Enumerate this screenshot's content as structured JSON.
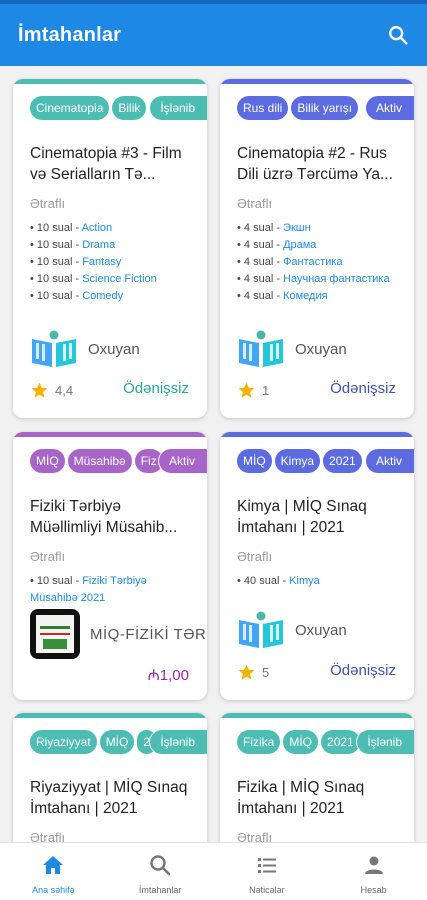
{
  "appbar": {
    "title": "İmtahanlar",
    "search_icon": "search-icon"
  },
  "cards": [
    {
      "tags": [
        "Cinematopia",
        "Bilik"
      ],
      "status": "İşlənib",
      "title": "Cinematopia #3 - Film və Serialların Tə...",
      "detail": "Ətraflı",
      "items": [
        {
          "count": "10 sual",
          "topic": "Action"
        },
        {
          "count": "10 sual",
          "topic": "Drama"
        },
        {
          "count": "10 sual",
          "topic": "Fantasy"
        },
        {
          "count": "10 sual",
          "topic": "Science Fiction"
        },
        {
          "count": "10 sual",
          "topic": "Comedy"
        }
      ],
      "author": "Oxuyan",
      "rating": "4,4",
      "price": "Ödənişsiz"
    },
    {
      "tags": [
        "Rus dili",
        "Bilik yarışı"
      ],
      "status": "Aktiv",
      "title": "Cinematopia #2 - Rus Dili üzrə Tərcümə Ya...",
      "detail": "Ətraflı",
      "items": [
        {
          "count": "4 sual",
          "topic": "Экшн"
        },
        {
          "count": "4 sual",
          "topic": "Драма"
        },
        {
          "count": "4 sual",
          "topic": "Фантастика"
        },
        {
          "count": "4 sual",
          "topic": "Научная фантастика"
        },
        {
          "count": "4 sual",
          "topic": "Комедия"
        }
      ],
      "author": "Oxuyan",
      "rating": "1",
      "price": "Ödənişsiz"
    },
    {
      "tags": [
        "MİQ",
        "Müsahibə",
        "Fiz"
      ],
      "status": "Aktiv",
      "title": "Fiziki Tərbiyə Müəllimliyi Müsahib...",
      "detail": "Ətraflı",
      "items": [
        {
          "count": "10 sual",
          "topic": "Fiziki Tərbiyə Müsahibə 2021"
        }
      ],
      "author": "MİQ-FİZİKİ TƏRBİYƏ",
      "price": "₼1,00"
    },
    {
      "tags": [
        "MİQ",
        "Kimya",
        "2021"
      ],
      "status": "Aktiv",
      "title": "Kimya | MİQ Sınaq İmtahanı | 2021",
      "detail": "Ətraflı",
      "items": [
        {
          "count": "40 sual",
          "topic": "Kimya"
        }
      ],
      "author": "Oxuyan",
      "rating": "5",
      "price": "Ödənişsiz"
    },
    {
      "tags": [
        "Riyaziyyat",
        "MİQ",
        "2"
      ],
      "status": "İşlənib",
      "title": "Riyaziyyat | MİQ Sınaq İmtahanı | 2021",
      "detail": "Ətraflı"
    },
    {
      "tags": [
        "Fizika",
        "MİQ",
        "2021"
      ],
      "status": "İşlənib",
      "title": "Fizika | MİQ Sınaq İmtahanı | 2021",
      "detail": "Ətraflı"
    }
  ],
  "bottom_nav": [
    {
      "label": "Ana səhifə",
      "icon": "home-icon"
    },
    {
      "label": "İmtahanlar",
      "icon": "search-icon"
    },
    {
      "label": "Nəticələr",
      "icon": "list-icon"
    },
    {
      "label": "Hesab",
      "icon": "person-icon"
    }
  ],
  "colors": {
    "appbar": "#1e88e5",
    "teal": "#4dbdb3",
    "indigo": "#5c6bdf",
    "purple": "#a865c9",
    "star": "#f6b400",
    "price_teal": "#26a69a",
    "price_indigo": "#3f51b5",
    "price_purple": "#9c27b0"
  }
}
